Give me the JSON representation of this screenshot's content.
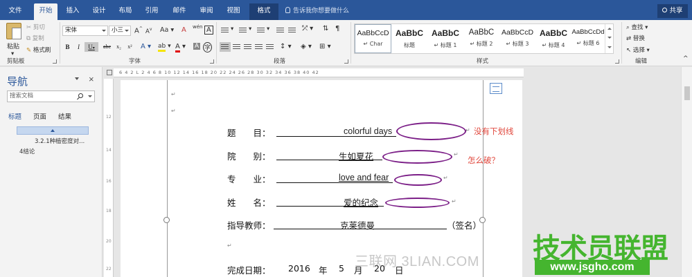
{
  "tabs": [
    {
      "label": "文件"
    },
    {
      "label": "开始"
    },
    {
      "label": "插入"
    },
    {
      "label": "设计"
    },
    {
      "label": "布局"
    },
    {
      "label": "引用"
    },
    {
      "label": "邮件"
    },
    {
      "label": "审阅"
    },
    {
      "label": "视图"
    },
    {
      "label": "格式"
    }
  ],
  "tell_me": "告诉我你想要做什么",
  "share": "共享",
  "ribbon": {
    "paste": "粘贴",
    "cut": "剪切",
    "copy": "复制",
    "format_painter": "格式刷",
    "clipboard_label": "剪贴板",
    "font_name": "宋体",
    "font_size": "小三",
    "font_label": "字体",
    "paragraph_label": "段落",
    "styles_label": "样式",
    "editing_label": "编辑",
    "find": "查找",
    "replace": "替换",
    "select": "选择",
    "bold": "B",
    "italic": "I",
    "underline": "U",
    "strike": "abc",
    "subscript": "x₂",
    "superscript": "x²",
    "grow_font": "A",
    "shrink_font": "A",
    "change_case": "Aa",
    "clear_format": "A",
    "phonetic": "wén",
    "char_border": "A",
    "text_effects": "A",
    "highlight": "ab",
    "font_color": "A",
    "char_shading": "A",
    "enclose_char": "字",
    "styles": [
      {
        "sample": "AaBbCcD",
        "name": "↵ Char"
      },
      {
        "sample": "AaBbC",
        "name": "标题"
      },
      {
        "sample": "AaBbC",
        "name": "↵ 标题 1"
      },
      {
        "sample": "AaBbC",
        "name": "↵ 标题 2"
      },
      {
        "sample": "AaBbCcD",
        "name": "↵ 标题 3"
      },
      {
        "sample": "AaBbC",
        "name": "↵ 标题 4"
      },
      {
        "sample": "AaBbCcDd",
        "name": "↵ 标题 6"
      }
    ]
  },
  "nav": {
    "title": "导航",
    "close": "×",
    "search_placeholder": "搜索文档",
    "tabs": [
      {
        "label": "标题"
      },
      {
        "label": "页面"
      },
      {
        "label": "结果"
      }
    ],
    "items": [
      {
        "label": "3.2.1种植密度对..."
      },
      {
        "label": "4结论"
      }
    ]
  },
  "ruler_text": "6  4  2  L  2  4  6  8  10  12  14  16  18  20  22  24  26  28  30  32  34  36  38  40  42",
  "ruler_vertical_numbers": [
    "12",
    "14",
    "16",
    "18",
    "20",
    "22"
  ],
  "document": {
    "fields": [
      {
        "label": "题　　目：",
        "value": "colorful days"
      },
      {
        "label": "院　　别：",
        "value": "生如夏花"
      },
      {
        "label": "专　　业：",
        "value": "love and fear"
      },
      {
        "label": "姓　　名：",
        "value": "爱的纪念"
      },
      {
        "label": "指导教师：",
        "value": "克莱德曼",
        "suffix": "（签名）"
      }
    ],
    "date": {
      "label": "完成日期：",
      "year": "2016",
      "year_unit": "年",
      "month": "5",
      "month_unit": "月",
      "day": "20",
      "day_unit": "日"
    },
    "paragraph_mark": "↵"
  },
  "annotations": {
    "line1": "没有下划线",
    "line2": "怎么破？"
  },
  "annotation_color": "#e0463b",
  "ellipse_color": "#7b1e87",
  "accent_color": "#2b579a",
  "watermarks": {
    "site1": "三联网 3LIAN.COM",
    "site2": "技术员联盟",
    "site3": "www.jsgho.com"
  }
}
